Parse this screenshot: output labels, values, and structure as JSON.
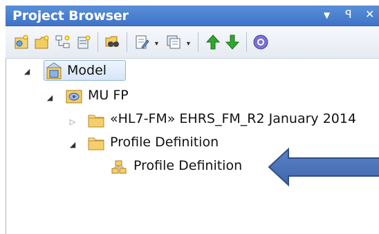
{
  "window": {
    "title": "Project Browser",
    "controls": {
      "dropdown": "▼",
      "pin": "ꟼ",
      "close": "✕"
    }
  },
  "toolbar": {
    "buttons": [
      {
        "name": "new-model-icon"
      },
      {
        "name": "new-package-icon"
      },
      {
        "name": "new-diagram-icon"
      },
      {
        "name": "new-element-icon"
      },
      {
        "name": "find-icon"
      },
      {
        "name": "notes-icon"
      },
      {
        "name": "generate-icon"
      },
      {
        "name": "move-up-icon"
      },
      {
        "name": "move-down-icon"
      },
      {
        "name": "help-icon"
      }
    ],
    "colors": {
      "up": "#2ea82e",
      "down": "#2ea82e",
      "help": "#7b6fd3"
    }
  },
  "tree": {
    "nodes": [
      {
        "label": "Model",
        "expander": "◢",
        "icon": "model-root-icon",
        "selected": true
      },
      {
        "label": "MU FP",
        "expander": "◢",
        "icon": "view-package-icon"
      },
      {
        "label": "«HL7-FM» EHRS_FM_R2 January 2014",
        "expander": "▷",
        "icon": "folder-icon"
      },
      {
        "label": "Profile Definition",
        "expander": "◢",
        "icon": "folder-icon"
      },
      {
        "label": "Profile Definition",
        "expander": "",
        "icon": "profile-definition-icon"
      }
    ]
  },
  "annotation": {
    "icon": "callout-arrow-icon",
    "color": "#4a72b8"
  }
}
